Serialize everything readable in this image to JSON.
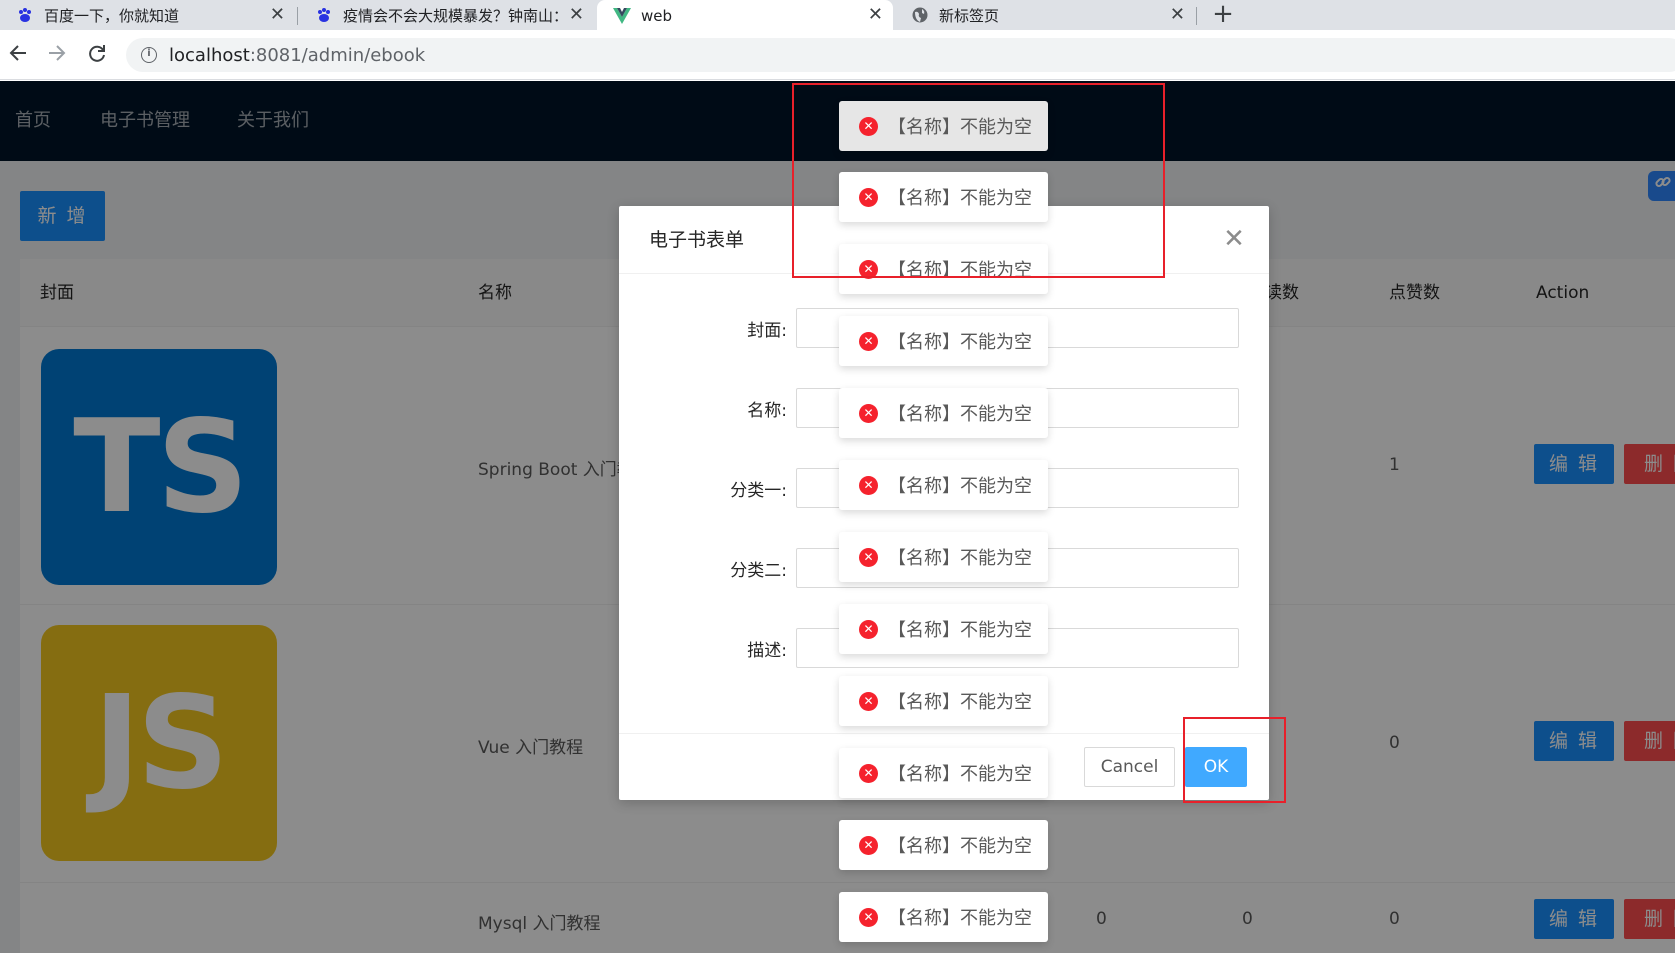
{
  "browser": {
    "tabs": [
      {
        "title": "百度一下，你就知道",
        "favicon": "baidu-paw-icon"
      },
      {
        "title": "疫情会不会大规模暴发？钟南山：",
        "favicon": "baidu-paw-icon"
      },
      {
        "title": "web",
        "favicon": "vue-logo-icon"
      },
      {
        "title": "新标签页",
        "favicon": "globe-icon"
      }
    ],
    "new_tab": "+",
    "close_glyph": "✕",
    "address": {
      "host": "localhost",
      "rest": ":8081/admin/ebook"
    }
  },
  "header": {
    "menu": [
      {
        "label": "首页"
      },
      {
        "label": "电子书管理"
      },
      {
        "label": "关于我们"
      }
    ]
  },
  "page": {
    "add_label": "新 增",
    "columns": {
      "cover": "封面",
      "name": "名称",
      "views_partial": "读数",
      "votes": "点赞数",
      "action": "Action"
    },
    "rows": [
      {
        "cover_text": "TS",
        "cover_color": "#0079d4",
        "name": "Spring Boot 入门教",
        "col_c": "",
        "col_d": "",
        "votes": "1",
        "edit": "编 辑",
        "delete": "删 除"
      },
      {
        "cover_text": "JS",
        "cover_color": "#f2c720",
        "name": "Vue 入门教程",
        "col_c": "",
        "col_d": "",
        "votes": "0",
        "edit": "编 辑",
        "delete": "删 除"
      },
      {
        "cover_text": "",
        "cover_color": "",
        "name": "Mysql 入门教程",
        "col_c": "0",
        "col_d": "0",
        "votes": "0",
        "edit": "编 辑",
        "delete": "删 除"
      }
    ]
  },
  "modal": {
    "title": "电子书表单",
    "close_glyph": "✕",
    "fields": [
      {
        "label": "封面:"
      },
      {
        "label": "名称:"
      },
      {
        "label": "分类一:"
      },
      {
        "label": "分类二:"
      },
      {
        "label": "描述:"
      }
    ],
    "cancel_label": "Cancel",
    "ok_label": "OK"
  },
  "messages": {
    "text": "【名称】不能为空",
    "icon": "error-circle-icon",
    "count": 12
  },
  "colors": {
    "primary": "#1890ff",
    "danger": "#ff4d4f",
    "header_bg": "#001529",
    "error_icon": "#f5222d",
    "annotation": "#e8202a"
  }
}
